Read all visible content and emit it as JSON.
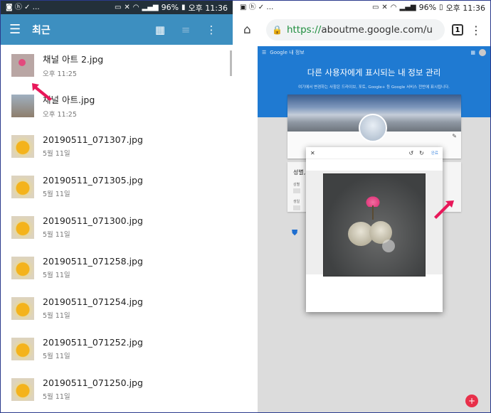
{
  "left_phone": {
    "status": {
      "time": "오후 11:36",
      "battery": "96%"
    },
    "appbar": {
      "title": "최근",
      "menu_icon": "hamburger-icon",
      "grid_icon": "grid-view-icon",
      "sort_icon": "sort-icon",
      "more_icon": "more-vert-icon"
    },
    "files": [
      {
        "name": "채널 아트 2.jpg",
        "date": "오후 11:25",
        "thumb": "lotus"
      },
      {
        "name": "채널 아트.jpg",
        "date": "오후 11:25",
        "thumb": "tree"
      },
      {
        "name": "20190511_071307.jpg",
        "date": "5월 11일",
        "thumb": "egg"
      },
      {
        "name": "20190511_071305.jpg",
        "date": "5월 11일",
        "thumb": "egg"
      },
      {
        "name": "20190511_071300.jpg",
        "date": "5월 11일",
        "thumb": "egg"
      },
      {
        "name": "20190511_071258.jpg",
        "date": "5월 11일",
        "thumb": "egg"
      },
      {
        "name": "20190511_071254.jpg",
        "date": "5월 11일",
        "thumb": "egg"
      },
      {
        "name": "20190511_071252.jpg",
        "date": "5월 11일",
        "thumb": "egg"
      },
      {
        "name": "20190511_071250.jpg",
        "date": "5월 11일",
        "thumb": "egg"
      }
    ]
  },
  "right_phone": {
    "status": {
      "time": "오후 11:36",
      "battery": "96%"
    },
    "browser": {
      "url_scheme": "https://",
      "url_host": "aboutme.google.com/u",
      "tab_count": "1"
    },
    "page": {
      "brand": "Google 내 정보",
      "heading": "다른 사용자에게 표시되는 내 정보 관리",
      "subheading": "여기에서 변경하는 사항은 드라이브, 포토, Google+ 등 Google 서비스 전반에 표시됩니다.",
      "section_title": "성별,",
      "field_label_1": "성별",
      "field_label_2": "생일"
    },
    "dialog": {
      "done_label": "완료"
    }
  },
  "colors": {
    "appbar": "#3d8fc0",
    "google_blue": "#1f7ad2",
    "arrow": "#e8185a",
    "fab": "#e8304a"
  }
}
